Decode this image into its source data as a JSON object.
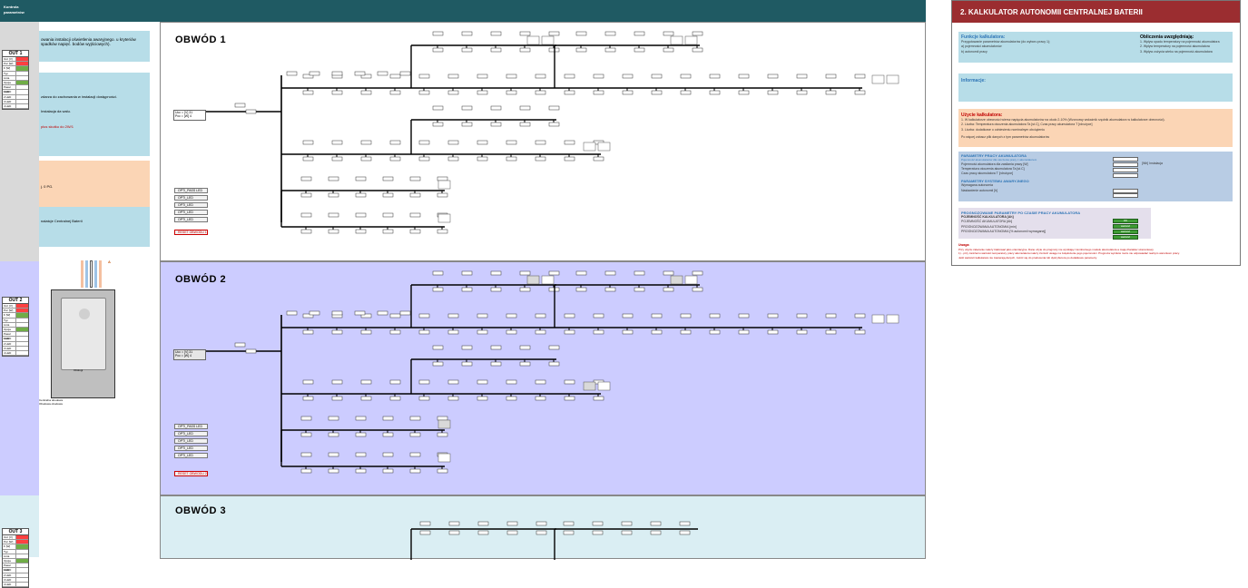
{
  "window": {
    "title_line1": "Kontrola",
    "title_line2": "parametrów"
  },
  "out_tables": [
    {
      "label": "OUT 1"
    },
    {
      "label": "OUT 2"
    },
    {
      "label": "OUT 3"
    }
  ],
  "out_rows": [
    "Ucc [V]",
    "Pcc [W]",
    "Σ [W]",
    "Typ",
    "Linia",
    "Opcja",
    "Pasal LED",
    "1 LED",
    "2 LED",
    "3 LED",
    "4 LED"
  ],
  "description": {
    "box1": "owania instalacji oświetlenia awaryjnego. u kryteriów spadków napięć. bodów wyjściowych).",
    "box2a": "zdarza do zachowania w instalacji dostępności.",
    "box2b": "Instalacja da walu.",
    "box2c": "plus skutku do 2W/1",
    "box3": "j. 0 PG.",
    "box4": "nalatcje Centralnej Baterii",
    "cabinet_label_a": "A",
    "cabinet_caption1": "Obsługi",
    "cabinet_caption2": "Centralna obudowa",
    "cabinet_caption3": "Obudowa obudowa"
  },
  "panels": [
    {
      "title": "OBWÓD 1",
      "supply_u": "Ucc = [V]  31",
      "supply_p": "Pcc = [W]  4"
    },
    {
      "title": "OBWÓD 2",
      "supply_u": "Ucc = [V]  31",
      "supply_p": "Pcc = [W]  4"
    },
    {
      "title": "OBWÓD 3"
    }
  ],
  "side_buttons": [
    "OPTI_PASS LED",
    "OPTI_LED",
    "OPTI_LED",
    "OPTI_LED",
    "OPTI_LED"
  ],
  "reset_label": "RESET OBWODU 1",
  "reset_label_2": "RESET OBWODU 2",
  "calculator": {
    "title": "2. KALKULATOR AUTONOMII CENTRALNEJ BATERII",
    "functions_title": "Funkcje kalkulatora:",
    "functions_lines": [
      "Przygotowanie parametrów akumulatorów (do wyboru pracy 1);",
      "a) pojemności akumulatorów",
      "b) autonomii pracy"
    ],
    "includes_title": "Obliczenia uwzględniają:",
    "includes_lines": [
      "1. Wpływ opadu temperatury na pojemność akumulatora",
      "2. Wpływ temperatury na pojemność akumulatora",
      "3. Wpływ zużycia wieku na pojemność akumulatora"
    ],
    "info_title": "Informacje:",
    "usage_title": "Użycie kalkulatora:",
    "usage_lines": [
      "1. W kalkulatorze obecności wiersz napięcia akumulatorów na około 2-10% (Wzorcowy wskaźnik rzędnik akumulatora w kalkulatorze obecności).",
      "2. Liczba: Temperatura otoczenia akumulatora Ta [st.C], Czas pracy akumulatora T [rdrożyce]",
      "3. Liczba: dodatkowe o odniesieniu nominalnym obciążeniu"
    ],
    "usage_note": "Po więcej zobacz plik danych z tym parametrów akumulatorów",
    "params_title": "PARAMETRY PRACY AKUMULATORA",
    "params_sub": "Pojemność akumulatorów dla otoczenia pracy z akumulatorem",
    "params_lines": [
      "Pojemność akumulatora dla zasilania pracy [W]",
      "Temperatura otoczenia akumulatora Ta [st.C]",
      "Czas pracy akumulatora T [rdrożyce]"
    ],
    "params_unit": "[Wh] Instalacja",
    "emergency_title": "PARAMETRY SYSTEMU AWARYJNEGO",
    "emergency_lines": [
      "Wymagana autonomia",
      "Nastawienie autonomii [h]"
    ],
    "forecast_title": "PROGNOZOWANE PARAMETRY PO CZASIE PRACY AKUMULATORA",
    "forecast_sub": "POJEMNOŚĆ KALKULATORA [Ah]",
    "forecast_lines": [
      "POJEMNOŚĆ AKUMULATORA [Ah]",
      "PROGNOZOWANA AUTONOMIA [min]",
      "PROGNOZOWANA AUTONOMIA [% autonomii wymaganej]"
    ],
    "forecast_values": [
      "OK",
      "wartość",
      "wartość",
      "wartość"
    ],
    "warnings_title": "Uwaga:",
    "warnings_lines": [
      "Przy użyciu zalecanie należy traktować jako orientacyjne. Dane użyte do prognozy nie wynikają z konkretnego modelu akumulatora a mają charakter szacunkowy.",
      "1) - przy zaniżeniu wartości temperatury pracy akumulatora należy zwrócić uwagę na zwiększenie jego pojemności. Prognoza wyników może nie odpowiadać realnym warunkom pracy.",
      "Jeśli wartości kalkulatora nie zawierają danych, zwróć się do producenta lub dystrybutora po dodatkowe parametry."
    ]
  },
  "colors": {
    "topbar": "#1f5a63",
    "panel1": "#ffffff",
    "panel2": "#ccccff",
    "panel3": "#daeef3",
    "calc_head": "#9b2d30",
    "light_blue_box": "#b7dde8",
    "peach_box": "#fbd5b5",
    "steel_box": "#b8cce4",
    "lavender_box": "#e4dfec"
  }
}
